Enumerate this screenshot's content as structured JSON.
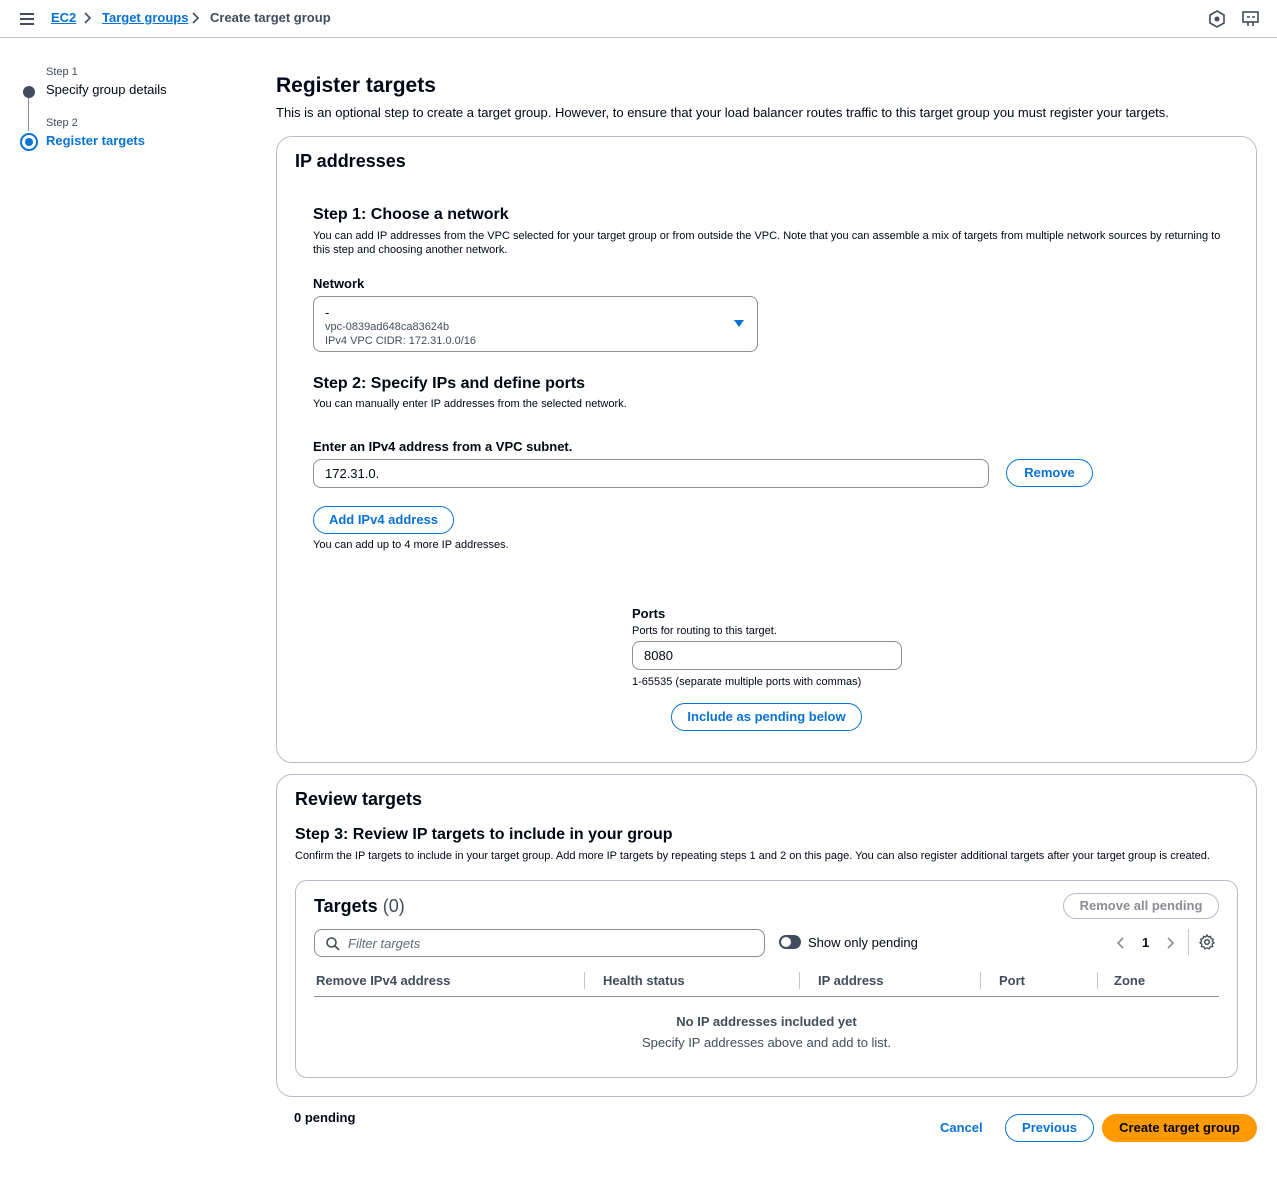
{
  "breadcrumb": {
    "items": [
      "EC2",
      "Target groups"
    ],
    "current": "Create target group"
  },
  "steps": [
    {
      "label": "Step 1",
      "name": "Specify group details"
    },
    {
      "label": "Step 2",
      "name": "Register targets"
    }
  ],
  "page": {
    "title": "Register targets",
    "description": "This is an optional step to create a target group. However, to ensure that your load balancer routes traffic to this target group you must register your targets."
  },
  "ip_card": {
    "title": "IP addresses",
    "step1": {
      "title": "Step 1: Choose a network",
      "description": "You can add IP addresses from the VPC selected for your target group or from outside the VPC. Note that you can assemble a mix of targets from multiple network sources by returning to this step and choosing another network."
    },
    "network": {
      "label": "Network",
      "selected_name": "-",
      "selected_vpc": "vpc-0839ad648ca83624b",
      "selected_cidr": "IPv4 VPC CIDR: 172.31.0.0/16"
    },
    "step2": {
      "title": "Step 2: Specify IPs and define ports",
      "description": "You can manually enter IP addresses from the selected network."
    },
    "ipv4": {
      "label": "Enter an IPv4 address from a VPC subnet.",
      "value": "172.31.0.",
      "remove_label": "Remove",
      "add_label": "Add IPv4 address",
      "hint": "You can add up to 4 more IP addresses."
    },
    "ports": {
      "label": "Ports",
      "description": "Ports for routing to this target.",
      "value": "8080",
      "constraint": "1-65535 (separate multiple ports with commas)",
      "include_label": "Include as pending below"
    }
  },
  "review_card": {
    "title": "Review targets",
    "step3_title": "Step 3: Review IP targets to include in your group",
    "step3_description": "Confirm the IP targets to include in your target group. Add more IP targets by repeating steps 1 and 2 on this page. You can also register additional targets after your target group is created.",
    "table": {
      "title": "Targets",
      "count": "(0)",
      "remove_all_label": "Remove all pending",
      "filter_placeholder": "Filter targets",
      "toggle_label": "Show only pending",
      "page": "1",
      "columns": [
        "Remove IPv4 address",
        "Health status",
        "IP address",
        "Port",
        "Zone"
      ],
      "empty_title": "No IP addresses included yet",
      "empty_description": "Specify IP addresses above and add to list."
    }
  },
  "footer": {
    "pending": "0 pending",
    "cancel": "Cancel",
    "previous": "Previous",
    "create": "Create target group"
  },
  "colors": {
    "link": "#0972d3",
    "primary": "#ff9900",
    "border": "#b6bec9"
  }
}
